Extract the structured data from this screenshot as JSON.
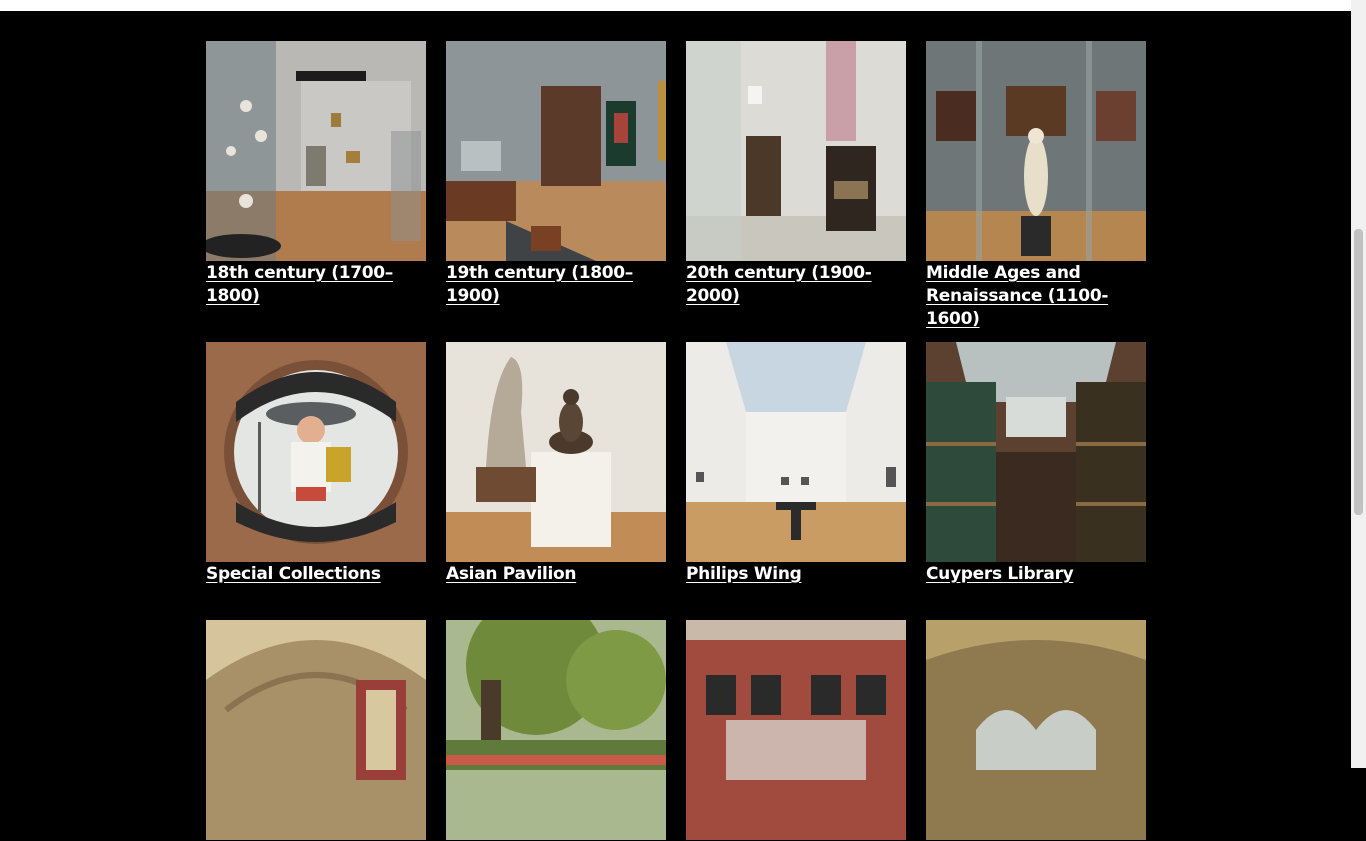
{
  "cards": [
    {
      "label": "18th century (1700–1800)",
      "image": "gallery-18th-century-icon"
    },
    {
      "label": "19th century (1800–1900)",
      "image": "gallery-19th-century-icon"
    },
    {
      "label": "20th century (1900-2000)",
      "image": "gallery-20th-century-icon"
    },
    {
      "label": "Middle Ages and Renaissance (1100-1600)",
      "image": "gallery-middle-ages-icon"
    },
    {
      "label": "Special Collections",
      "image": "tile-dwarf-icon"
    },
    {
      "label": "Asian Pavilion",
      "image": "buddha-statue-icon"
    },
    {
      "label": "Philips Wing",
      "image": "white-gallery-icon"
    },
    {
      "label": "Cuypers Library",
      "image": "library-icon"
    },
    {
      "label": "",
      "image": "vaulted-hall-icon"
    },
    {
      "label": "",
      "image": "garden-tree-icon"
    },
    {
      "label": "",
      "image": "brick-facade-icon"
    },
    {
      "label": "",
      "image": "arched-hall-icon"
    }
  ]
}
